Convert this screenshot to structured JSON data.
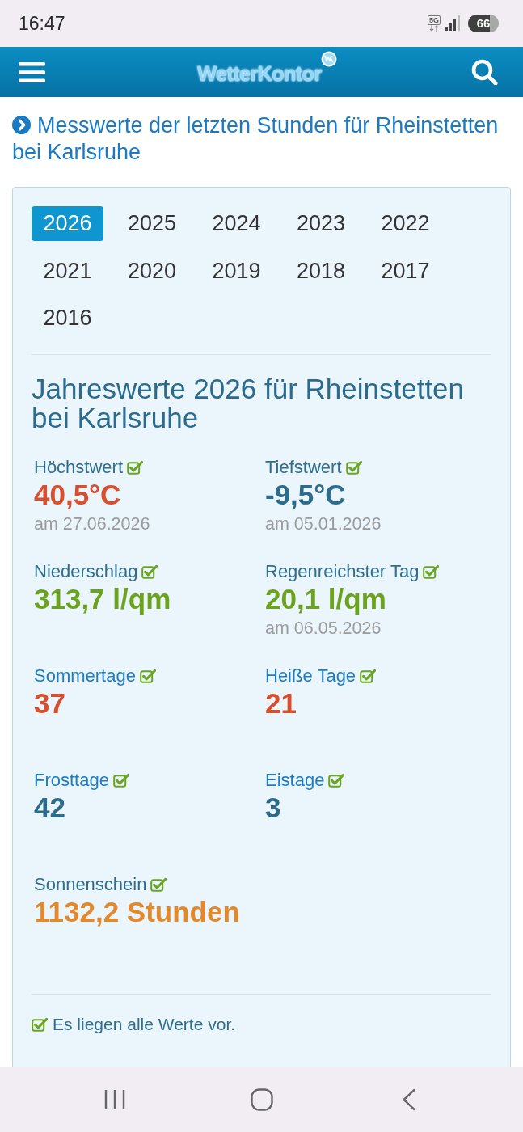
{
  "status_bar": {
    "time": "16:47",
    "network": "5G",
    "battery": "66"
  },
  "header": {
    "logo": "WetterKontor"
  },
  "link": {
    "text": "Messwerte der letzten Stunden für Rheinstetten bei Karlsruhe"
  },
  "years": [
    {
      "label": "2026",
      "selected": true
    },
    {
      "label": "2025",
      "selected": false
    },
    {
      "label": "2024",
      "selected": false
    },
    {
      "label": "2023",
      "selected": false
    },
    {
      "label": "2022",
      "selected": false
    },
    {
      "label": "2021",
      "selected": false
    },
    {
      "label": "2020",
      "selected": false
    },
    {
      "label": "2019",
      "selected": false
    },
    {
      "label": "2018",
      "selected": false
    },
    {
      "label": "2017",
      "selected": false
    },
    {
      "label": "2016",
      "selected": false
    }
  ],
  "heading": "Jahreswerte 2026 für Rheinstetten bei Karlsruhe",
  "stats": [
    {
      "label": "Höchstwert",
      "kind": "text",
      "checked": true,
      "value": "40,5°C",
      "color": "#d84f30",
      "date": "am 27.06.2026"
    },
    {
      "label": "Tiefstwert",
      "kind": "text",
      "checked": true,
      "value": "-9,5°C",
      "color": "#2c6b8c",
      "date": "am 05.01.2026"
    },
    {
      "label": "Niederschlag",
      "kind": "text",
      "checked": true,
      "value": "313,7 l/qm",
      "color": "#6ba31c"
    },
    {
      "label": "Regenreichster Tag",
      "kind": "text",
      "checked": true,
      "value": "20,1 l/qm",
      "color": "#6ba31c",
      "date": "am 06.05.2026"
    },
    {
      "label": "Sommertage",
      "kind": "link",
      "checked": true,
      "value": "37",
      "color": "#d84f30"
    },
    {
      "label": "Heiße Tage",
      "kind": "link",
      "checked": true,
      "value": "21",
      "color": "#d84f30"
    },
    {
      "label": "Frosttage",
      "kind": "link",
      "checked": true,
      "value": "42",
      "color": "#2c6b8c"
    },
    {
      "label": "Eistage",
      "kind": "link",
      "checked": true,
      "value": "3",
      "color": "#2c6b8c"
    },
    {
      "label": "Sonnenschein",
      "kind": "text",
      "checked": true,
      "value": "1132,2 Stunden",
      "color": "#e3892c"
    }
  ],
  "footer": {
    "text": "Es liegen alle Werte vor.",
    "checked": true
  }
}
